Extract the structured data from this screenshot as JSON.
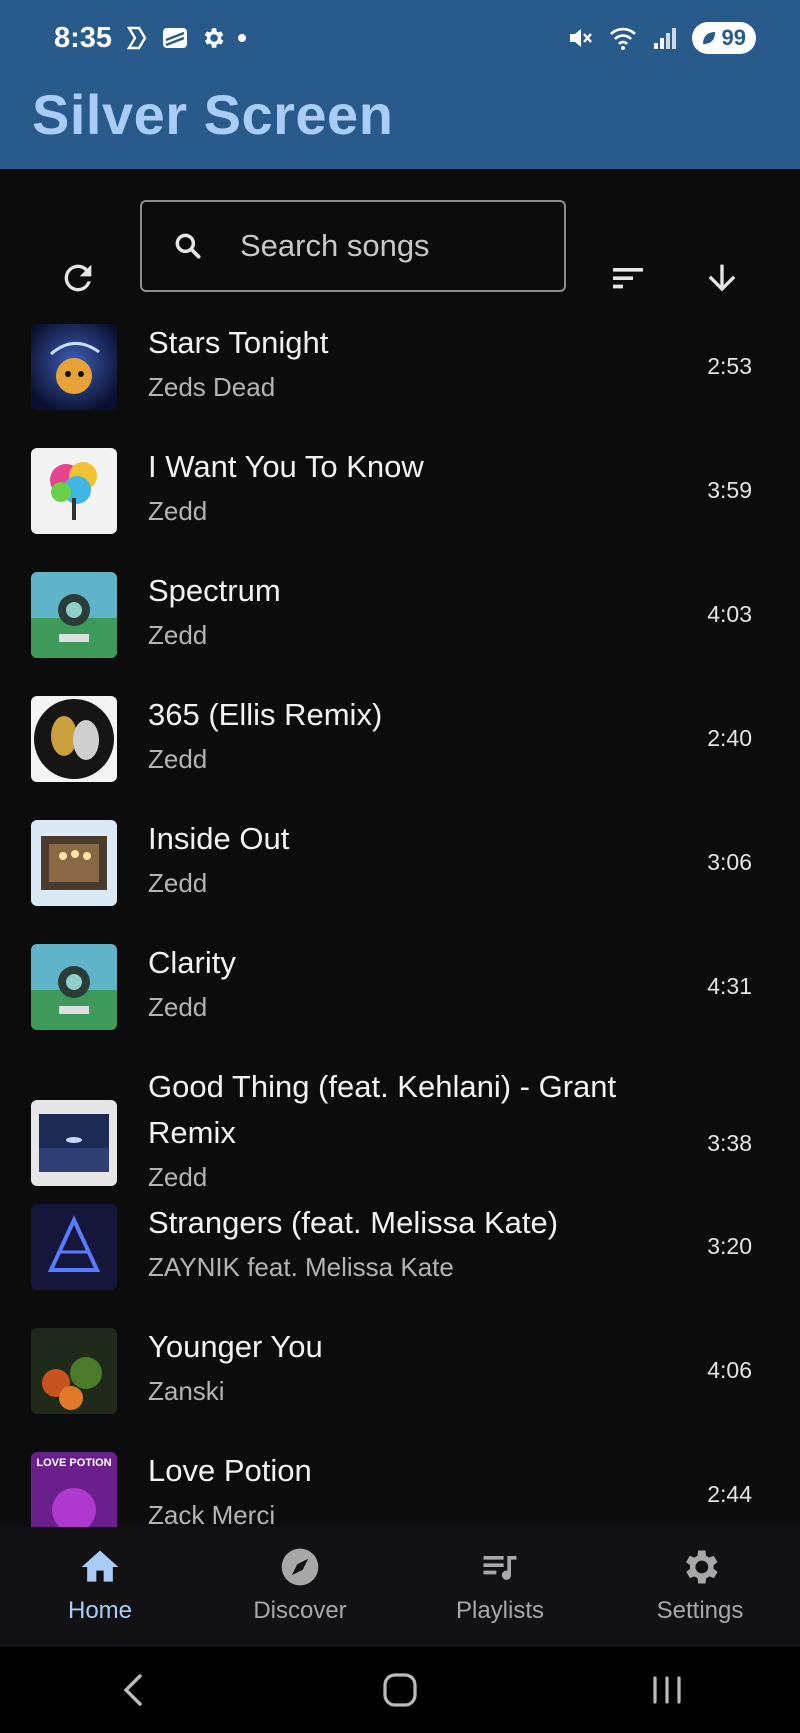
{
  "status_bar": {
    "time": "8:35",
    "battery": "99"
  },
  "app": {
    "title": "Silver Screen",
    "accent": "#a9cdf7",
    "header_bg": "#285a8c"
  },
  "toolbar": {
    "search_placeholder": "Search songs"
  },
  "songs": [
    {
      "title": "Stars Tonight",
      "artist": "Zeds Dead",
      "duration": "2:53"
    },
    {
      "title": "I Want You To Know",
      "artist": "Zedd",
      "duration": "3:59"
    },
    {
      "title": "Spectrum",
      "artist": "Zedd",
      "duration": "4:03"
    },
    {
      "title": "365 (Ellis Remix)",
      "artist": "Zedd",
      "duration": "2:40"
    },
    {
      "title": "Inside Out",
      "artist": "Zedd",
      "duration": "3:06"
    },
    {
      "title": "Clarity",
      "artist": "Zedd",
      "duration": "4:31"
    },
    {
      "title": "Good Thing (feat. Kehlani) - Grant Remix",
      "artist": "Zedd",
      "duration": "3:38"
    },
    {
      "title": "Strangers (feat. Melissa Kate)",
      "artist": "ZAYNIK feat. Melissa Kate",
      "duration": "3:20"
    },
    {
      "title": "Younger You",
      "artist": "Zanski",
      "duration": "4:06"
    },
    {
      "title": "Love Potion",
      "artist": "Zack Merci",
      "duration": "2:44"
    }
  ],
  "artwork_text": {
    "love_potion": "LOVE POTION"
  },
  "bottom_nav": [
    {
      "label": "Home",
      "icon": "home-icon",
      "active": true
    },
    {
      "label": "Discover",
      "icon": "compass-icon",
      "active": false
    },
    {
      "label": "Playlists",
      "icon": "playlist-icon",
      "active": false
    },
    {
      "label": "Settings",
      "icon": "gear-icon",
      "active": false
    }
  ]
}
